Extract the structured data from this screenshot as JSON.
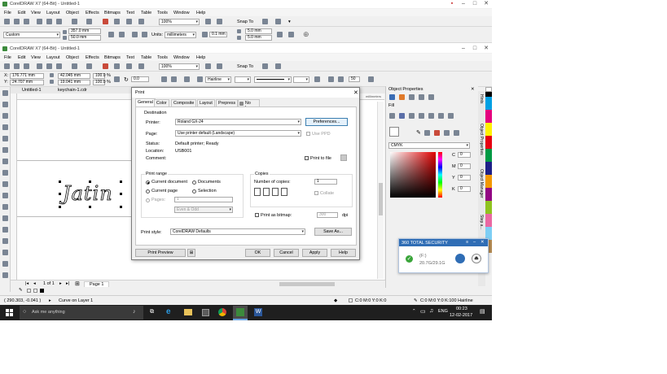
{
  "window1": {
    "title": "CorelDRAW X7 (64-Bit) - Untitled-1",
    "menu": [
      "File",
      "Edit",
      "View",
      "Layout",
      "Object",
      "Effects",
      "Bitmaps",
      "Text",
      "Table",
      "Tools",
      "Window",
      "Help"
    ],
    "zoom": "100%",
    "snap_to": "Snap To",
    "page_preset": "Custom",
    "width": "357.0 mm",
    "height": "50.0 mm",
    "units_label": "Units:",
    "units_value": "millimeters",
    "nudge": "0.1 mm",
    "dup_x": "5.0 mm",
    "dup_y": "5.0 mm"
  },
  "window2": {
    "title": "CorelDRAW X7 (64-Bit) - Untitled-1",
    "menu": [
      "File",
      "Edit",
      "View",
      "Layout",
      "Object",
      "Effects",
      "Bitmaps",
      "Text",
      "Table",
      "Tools",
      "Window",
      "Help"
    ],
    "zoom": "100%",
    "snap_to": "Snap To",
    "x": "176.771 mm",
    "y": "24.707 mm",
    "w": "42.045 mm",
    "h": "19.041 mm",
    "scale_w": "100.0",
    "scale_h": "100.0",
    "pct": "%",
    "rotation": "0.0",
    "outline": "Hairline",
    "outline_num": "50",
    "doc_tabs": [
      "Untitled-1",
      "keychain-1.cdr"
    ],
    "ruler_label": "millimeters",
    "canvas_text": "Jatin",
    "page_nav": "1 of 1",
    "page_tab": "Page 1"
  },
  "print_dialog": {
    "title": "Print",
    "tabs": [
      "General",
      "Color",
      "Composite",
      "Layout",
      "Prepress",
      "No Issues"
    ],
    "destination_label": "Destination",
    "printer_label": "Printer:",
    "printer_value": "Roland GX-24",
    "preferences": "Preferences...",
    "page_label": "Page:",
    "page_value": "Use printer default (Landscape)",
    "use_ppd": "Use PPD",
    "status_label": "Status:",
    "status_value": "Default printer; Ready",
    "location_label": "Location:",
    "location_value": "USB001",
    "comment_label": "Comment:",
    "print_to_file": "Print to file",
    "print_range_label": "Print range",
    "current_document": "Current document",
    "documents": "Documents",
    "current_page": "Current page",
    "selection": "Selection",
    "pages_label": "Pages:",
    "pages_value": "1",
    "even_odd": "Even & Odd",
    "copies_label": "Copies",
    "num_copies_label": "Number of copies:",
    "num_copies_value": "1",
    "collate": "Collate",
    "print_as_bitmap": "Print as bitmap:",
    "dpi_value": "300",
    "dpi_label": "dpi",
    "print_style_label": "Print style:",
    "print_style_value": "CorelDRAW Defaults",
    "save_as": "Save As...",
    "print_preview": "Print Preview",
    "ok": "OK",
    "cancel": "Cancel",
    "apply": "Apply",
    "help": "Help"
  },
  "object_properties": {
    "title": "Object Properties",
    "fill_label": "Fill",
    "color_model": "CMYK",
    "c_label": "C",
    "c_value": "0",
    "m_label": "M",
    "m_value": "0",
    "y_label": "Y",
    "y_value": "0",
    "k_label": "K",
    "k_value": "0",
    "side_tabs": [
      "Hints",
      "Object Properties",
      "Object Manager",
      "Step a..."
    ]
  },
  "security_popup": {
    "title": "360 TOTAL SECURITY",
    "drive": "(F:)",
    "size": "20.7G/29.1G"
  },
  "statusbar": {
    "coords": "( 290.303, -0.041 )",
    "object_info": "Curve on Layer 1",
    "fill_info": "C:0 M:0 Y:0 K:0",
    "outline_info": "C:0 M:0 Y:0 K:100  Hairline"
  },
  "taskbar": {
    "search_placeholder": "Ask me anything",
    "lang": "ENG",
    "time": "00:23",
    "date": "12-02-2017"
  },
  "colors": {
    "accent": "#0078d7",
    "corel_green": "#3c8a3c",
    "security_blue": "#2f6db5",
    "taskbar": "#1f1f1f",
    "close_red": "#e81123"
  }
}
